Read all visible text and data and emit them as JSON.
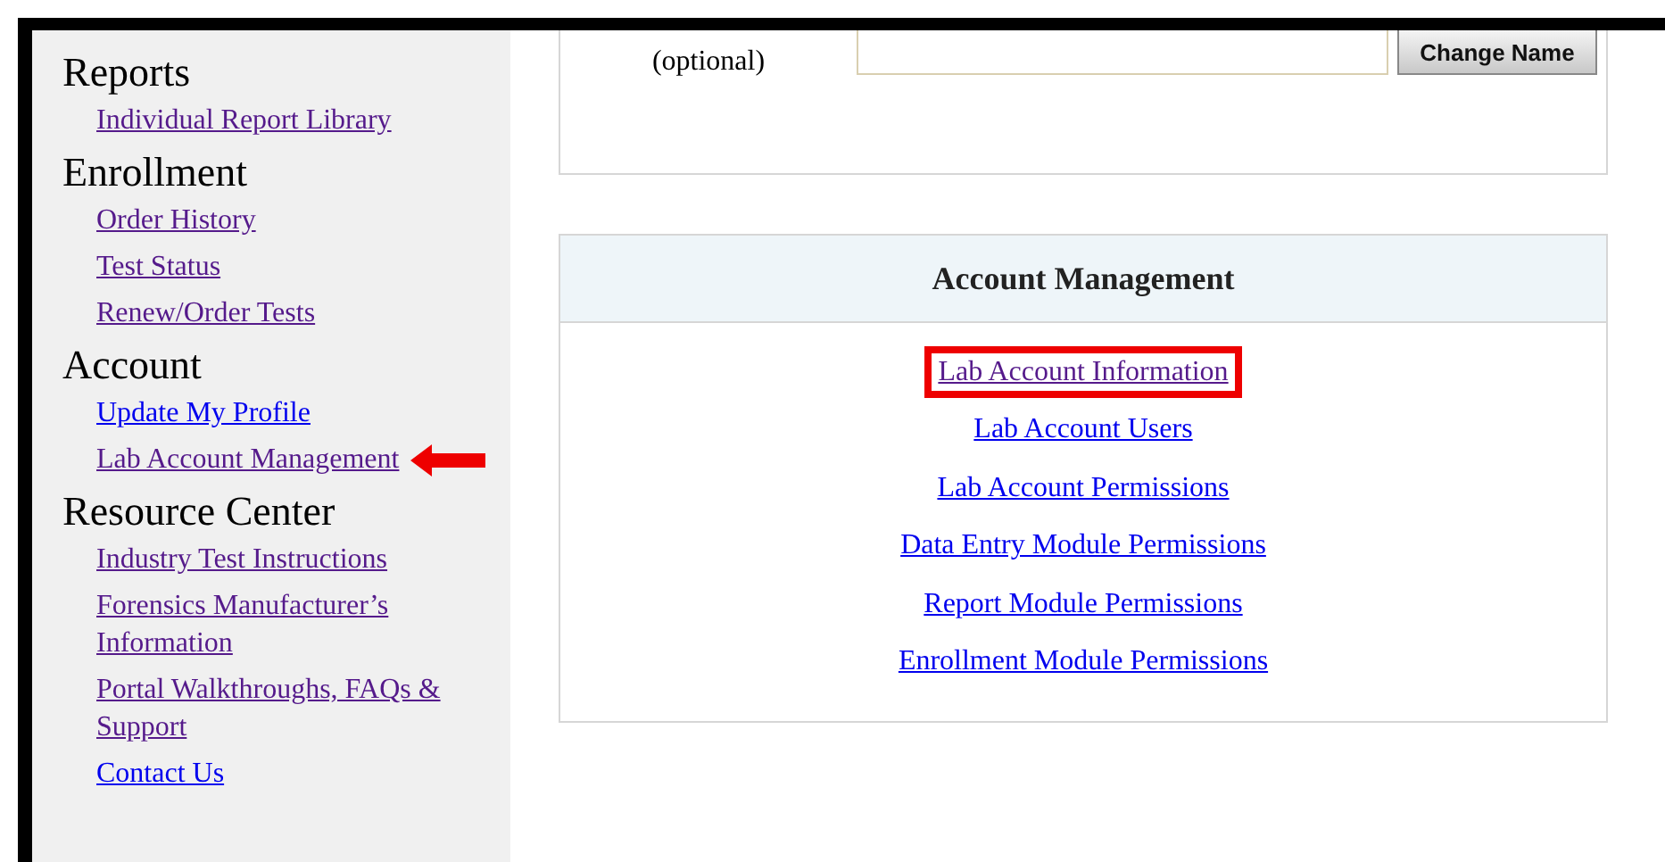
{
  "sidebar": {
    "sections": [
      {
        "heading": "Reports",
        "links": [
          {
            "label": "Individual Report Library",
            "visited": true,
            "pointer": false
          }
        ]
      },
      {
        "heading": "Enrollment",
        "links": [
          {
            "label": "Order History",
            "visited": true,
            "pointer": false
          },
          {
            "label": "Test Status",
            "visited": true,
            "pointer": false
          },
          {
            "label": "Renew/Order Tests",
            "visited": true,
            "pointer": false
          }
        ]
      },
      {
        "heading": "Account",
        "links": [
          {
            "label": "Update My Profile",
            "visited": false,
            "pointer": false
          },
          {
            "label": "Lab Account Management",
            "visited": true,
            "pointer": true
          }
        ]
      },
      {
        "heading": "Resource Center",
        "links": [
          {
            "label": "Industry Test Instructions",
            "visited": true,
            "pointer": false
          },
          {
            "label": "Forensics Manufacturer’s Information",
            "visited": true,
            "pointer": false
          },
          {
            "label": "Portal Walkthroughs, FAQs & Support",
            "visited": true,
            "pointer": false
          },
          {
            "label": "Contact Us",
            "visited": false,
            "pointer": false
          }
        ]
      }
    ]
  },
  "nickname_panel": {
    "label": "(optional)",
    "button": "Change Name"
  },
  "management_panel": {
    "title": "Account Management",
    "links": [
      {
        "label": "Lab Account Information",
        "visited": true,
        "highlighted": true
      },
      {
        "label": "Lab Account Users",
        "visited": false,
        "highlighted": false
      },
      {
        "label": "Lab Account Permissions",
        "visited": false,
        "highlighted": false
      },
      {
        "label": "Data Entry Module Permissions",
        "visited": false,
        "highlighted": false
      },
      {
        "label": "Report Module Permissions",
        "visited": false,
        "highlighted": false
      },
      {
        "label": "Enrollment Module Permissions",
        "visited": false,
        "highlighted": false
      }
    ]
  }
}
